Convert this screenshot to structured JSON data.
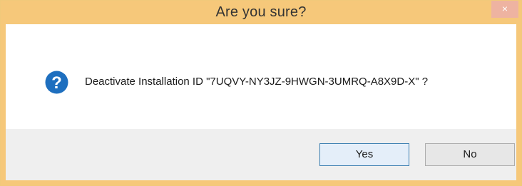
{
  "window": {
    "title": "Are you sure?",
    "close_glyph": "×",
    "title_bar_color": "#f6c87a"
  },
  "dialog": {
    "icon": "question-icon",
    "icon_color": "#1e6fbf",
    "message": "Deactivate Installation ID \"7UQVY-NY3JZ-9HWGN-3UMRQ-A8X9D-X\" ?"
  },
  "buttons": {
    "yes_label": "Yes",
    "no_label": "No"
  }
}
